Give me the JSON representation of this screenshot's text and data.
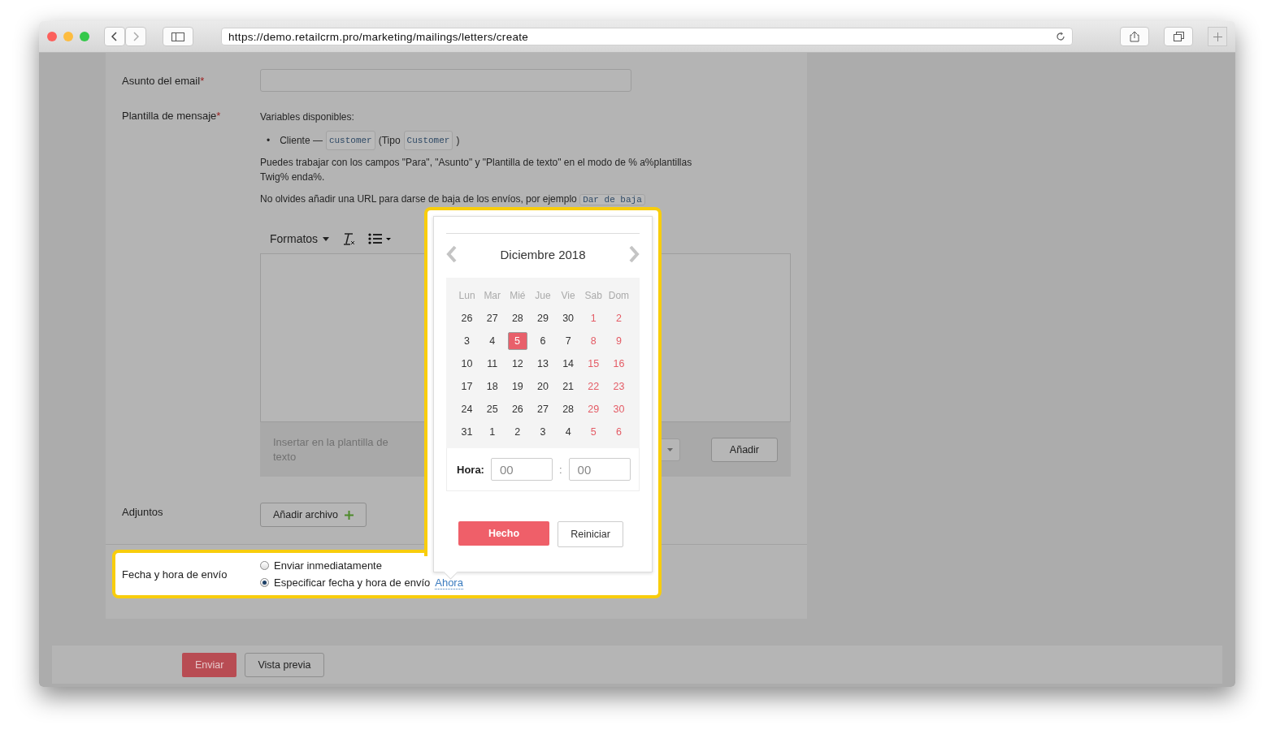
{
  "browser": {
    "url": "https://demo.retailcrm.pro/marketing/mailings/letters/create"
  },
  "form": {
    "subject": {
      "label": "Asunto del email",
      "required": "*"
    },
    "template": {
      "label": "Plantilla de mensaje",
      "required": "*",
      "variables_title": "Variables disponibles:",
      "variables": [
        {
          "bullet": "•",
          "name": "Cliente —",
          "code": "customer",
          "type_prefix": "(Tipo",
          "type_code": "Customer",
          "type_suffix": ")"
        }
      ],
      "note": "Puedes trabajar con los campos \"Para\", \"Asunto\" y \"Plantilla de texto\" en el modo de % a%plantillas Twig% enda%.",
      "unsubscribe_note": "No olvides añadir una URL para darse de baja de los envíos, por ejemplo",
      "unsubscribe_code": "Dar de baja",
      "toolbar": {
        "formats": "Formatos"
      },
      "insert_label": "Insertar en la plantilla de texto",
      "insert_button": "Añadir"
    },
    "attachments": {
      "label": "Adjuntos",
      "button": "Añadir archivo"
    },
    "send_time": {
      "label": "Fecha y hora de envío",
      "options": [
        {
          "label": "Enviar inmediatamente",
          "selected": false
        },
        {
          "label": "Especificar fecha y hora de envío",
          "selected": true,
          "link": "Ahora"
        }
      ]
    }
  },
  "datepicker": {
    "month": "Diciembre 2018",
    "weekdays": [
      "Lun",
      "Mar",
      "Mié",
      "Jue",
      "Vie",
      "Sab",
      "Dom"
    ],
    "weeks": [
      [
        {
          "d": "26",
          "weekend": false,
          "selected": false
        },
        {
          "d": "27",
          "weekend": false,
          "selected": false
        },
        {
          "d": "28",
          "weekend": false,
          "selected": false
        },
        {
          "d": "29",
          "weekend": false,
          "selected": false
        },
        {
          "d": "30",
          "weekend": false,
          "selected": false
        },
        {
          "d": "1",
          "weekend": true,
          "selected": false
        },
        {
          "d": "2",
          "weekend": true,
          "selected": false
        }
      ],
      [
        {
          "d": "3",
          "weekend": false,
          "selected": false
        },
        {
          "d": "4",
          "weekend": false,
          "selected": false
        },
        {
          "d": "5",
          "weekend": false,
          "selected": true
        },
        {
          "d": "6",
          "weekend": false,
          "selected": false
        },
        {
          "d": "7",
          "weekend": false,
          "selected": false
        },
        {
          "d": "8",
          "weekend": true,
          "selected": false
        },
        {
          "d": "9",
          "weekend": true,
          "selected": false
        }
      ],
      [
        {
          "d": "10",
          "weekend": false,
          "selected": false
        },
        {
          "d": "11",
          "weekend": false,
          "selected": false
        },
        {
          "d": "12",
          "weekend": false,
          "selected": false
        },
        {
          "d": "13",
          "weekend": false,
          "selected": false
        },
        {
          "d": "14",
          "weekend": false,
          "selected": false
        },
        {
          "d": "15",
          "weekend": true,
          "selected": false
        },
        {
          "d": "16",
          "weekend": true,
          "selected": false
        }
      ],
      [
        {
          "d": "17",
          "weekend": false,
          "selected": false
        },
        {
          "d": "18",
          "weekend": false,
          "selected": false
        },
        {
          "d": "19",
          "weekend": false,
          "selected": false
        },
        {
          "d": "20",
          "weekend": false,
          "selected": false
        },
        {
          "d": "21",
          "weekend": false,
          "selected": false
        },
        {
          "d": "22",
          "weekend": true,
          "selected": false
        },
        {
          "d": "23",
          "weekend": true,
          "selected": false
        }
      ],
      [
        {
          "d": "24",
          "weekend": false,
          "selected": false
        },
        {
          "d": "25",
          "weekend": false,
          "selected": false
        },
        {
          "d": "26",
          "weekend": false,
          "selected": false
        },
        {
          "d": "27",
          "weekend": false,
          "selected": false
        },
        {
          "d": "28",
          "weekend": false,
          "selected": false
        },
        {
          "d": "29",
          "weekend": true,
          "selected": false
        },
        {
          "d": "30",
          "weekend": true,
          "selected": false
        }
      ],
      [
        {
          "d": "31",
          "weekend": false,
          "selected": false
        },
        {
          "d": "1",
          "weekend": false,
          "selected": false
        },
        {
          "d": "2",
          "weekend": false,
          "selected": false
        },
        {
          "d": "3",
          "weekend": false,
          "selected": false
        },
        {
          "d": "4",
          "weekend": false,
          "selected": false
        },
        {
          "d": "5",
          "weekend": true,
          "selected": false
        },
        {
          "d": "6",
          "weekend": true,
          "selected": false
        }
      ]
    ],
    "time_label": "Hora:",
    "hours": "00",
    "separator": ":",
    "minutes": "00",
    "done": "Hecho",
    "reset": "Reiniciar"
  },
  "footer": {
    "send": "Enviar",
    "preview": "Vista previa"
  }
}
